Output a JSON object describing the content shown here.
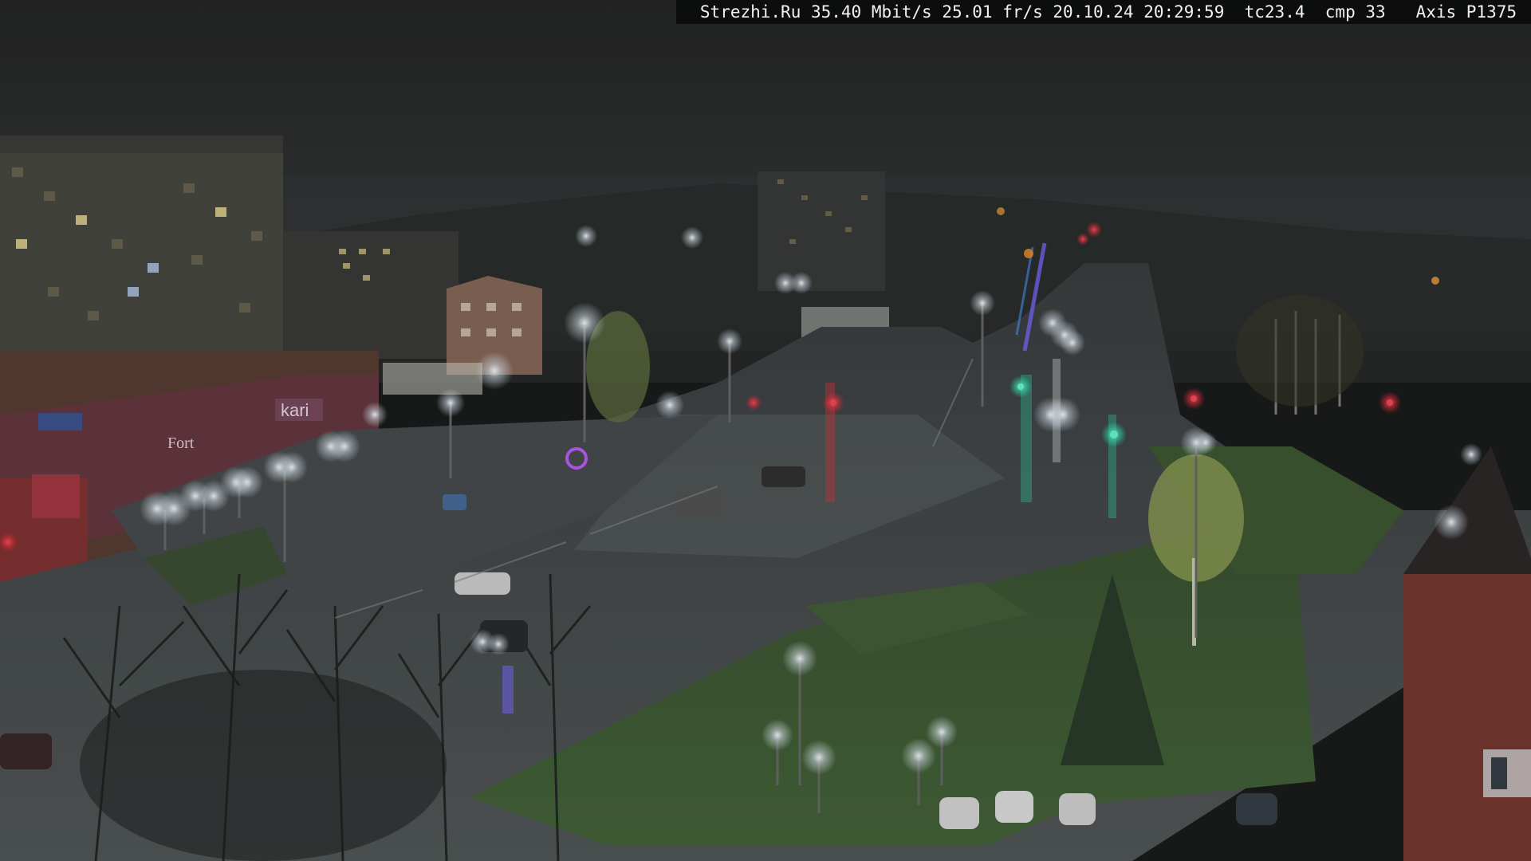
{
  "camera_overlay": {
    "text": "Strezhi.Ru 35.40 Mbit/s 25.01 fr/s 20.10.24 20:29:59  tc23.4  cmp 33   Axis P1375"
  },
  "scene": {
    "storefront_sign_left": "kari",
    "storefront_sign_mid": "Fort"
  },
  "colors": {
    "sky": "#2a2b2c",
    "fog": "#3a3c3c",
    "road_wet": "#4a4e50",
    "grass": "#3f5a34",
    "lamp_glow": "#eef6ff",
    "traffic_red": "#ff2a3a",
    "traffic_green": "#2affc8",
    "building_brick": "#8a3a30"
  }
}
